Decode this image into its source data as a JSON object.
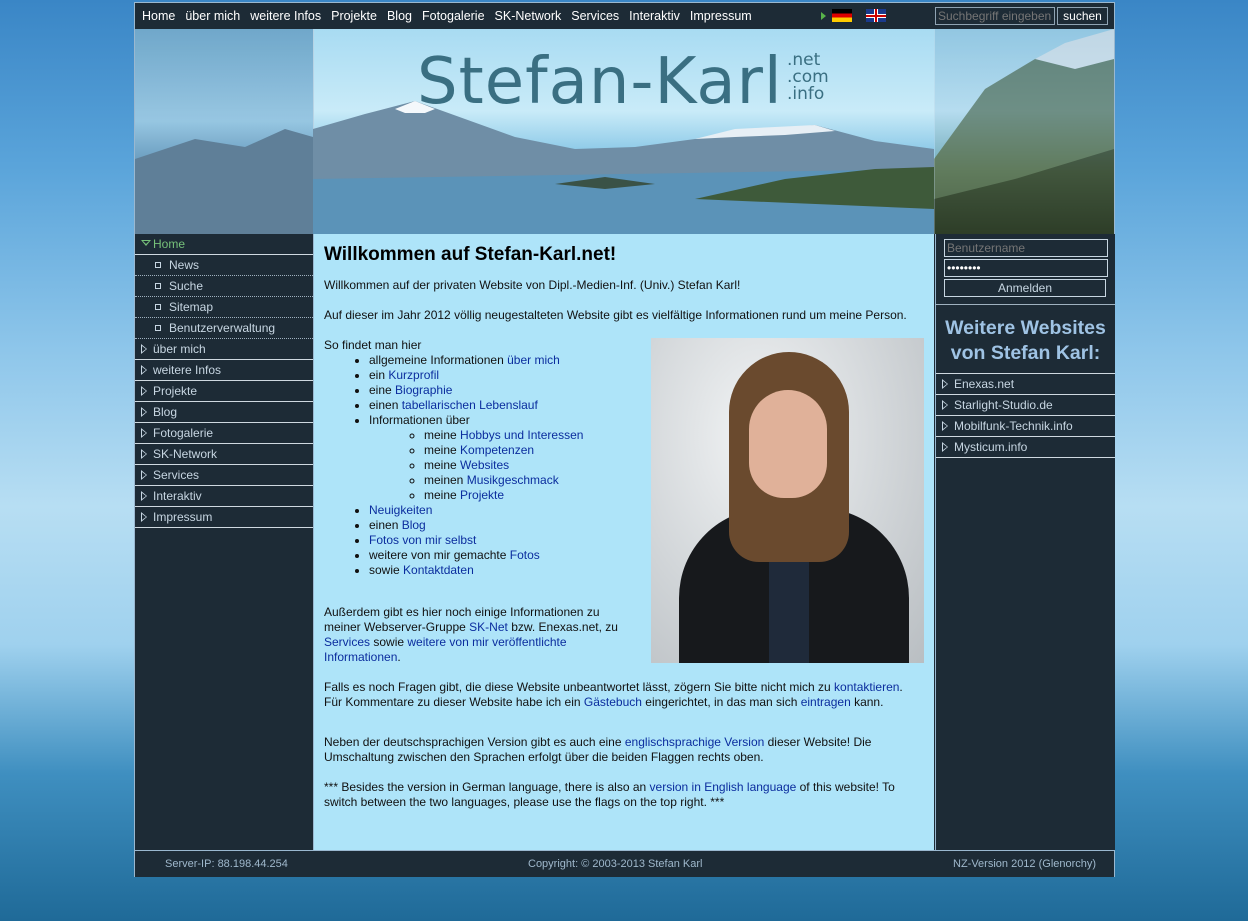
{
  "topnav": [
    "Home",
    "über mich",
    "weitere Infos",
    "Projekte",
    "Blog",
    "Fotogalerie",
    "SK-Network",
    "Services",
    "Interaktiv",
    "Impressum"
  ],
  "search": {
    "placeholder": "Suchbegriff eingeben",
    "button": "suchen"
  },
  "logo": {
    "main": "Stefan-Karl",
    "tlds": [
      ".net",
      ".com",
      ".info"
    ]
  },
  "leftnav": {
    "active": "Home",
    "subitems": [
      "News",
      "Suche",
      "Sitemap",
      "Benutzerverwaltung"
    ],
    "items": [
      "über mich",
      "weitere Infos",
      "Projekte",
      "Blog",
      "Fotogalerie",
      "SK-Network",
      "Services",
      "Interaktiv",
      "Impressum"
    ]
  },
  "content": {
    "title": "Willkommen auf Stefan-Karl.net!",
    "p1": "Willkommen auf der privaten Website von Dipl.-Medien-Inf. (Univ.) Stefan Karl!",
    "p2": "Auf dieser im Jahr 2012 völlig neugestalteten Website gibt es vielfältige Informationen rund um meine Person.",
    "list_intro": "So findet man hier",
    "list": {
      "l1": {
        "pre": "allgemeine Informationen ",
        "link": "über mich"
      },
      "l2": {
        "pre": "ein ",
        "link": "Kurzprofil"
      },
      "l3": {
        "pre": "eine ",
        "link": "Biographie"
      },
      "l4": {
        "pre": "einen ",
        "link": "tabellarischen Lebenslauf"
      },
      "l5": {
        "pre": "Informationen über"
      },
      "s1": {
        "pre": "meine ",
        "link": "Hobbys und Interessen"
      },
      "s2": {
        "pre": "meine ",
        "link": "Kompetenzen"
      },
      "s3": {
        "pre": "meine ",
        "link": "Websites"
      },
      "s4": {
        "pre": "meinen ",
        "link": "Musikgeschmack"
      },
      "s5": {
        "pre": "meine ",
        "link": "Projekte"
      },
      "l6": {
        "link": "Neuigkeiten"
      },
      "l7": {
        "pre": "einen ",
        "link": "Blog"
      },
      "l8": {
        "link": "Fotos von mir selbst"
      },
      "l9": {
        "pre": "weitere von mir gemachte ",
        "link": "Fotos"
      },
      "l10": {
        "pre": "sowie ",
        "link": "Kontaktdaten"
      }
    },
    "p3": {
      "t1": "Außerdem gibt es hier noch einige Informationen zu meiner Webserver-Gruppe ",
      "a1": "SK-Net",
      "t2": " bzw. Enexas.net, zu ",
      "a2": "Services",
      "t3": " sowie ",
      "a3": "weitere von mir veröffentlichte Informationen",
      "t4": "."
    },
    "p4": {
      "t1": "Falls es noch Fragen gibt, die diese Website unbeantwortet lässt, zögern Sie bitte nicht mich zu ",
      "a1": "kontaktieren",
      "t2": ". Für Kommentare zu dieser Website habe ich ein ",
      "a2": "Gästebuch",
      "t3": " eingerichtet, in das man sich ",
      "a3": "eintragen",
      "t4": " kann."
    },
    "p5": {
      "t1": "Neben der deutschsprachigen Version gibt es auch eine ",
      "a1": "englischsprachige Version",
      "t2": " dieser Website! Die Umschaltung zwischen den Sprachen erfolgt über die beiden Flaggen rechts oben."
    },
    "p6": {
      "t1": "*** Besides the version in German language, there is also an ",
      "a1": "version in English language",
      "t2": " of this website! To switch between the two languages, please use the flags on the top right. ***"
    }
  },
  "login": {
    "username_placeholder": "Benutzername",
    "password_value": "********",
    "button": "Anmelden"
  },
  "more": {
    "title": "Weitere Websites von Stefan Karl:",
    "sites": [
      "Enexas.net",
      "Starlight-Studio.de",
      "Mobilfunk-Technik.info",
      "Mysticum.info"
    ]
  },
  "footer": {
    "ip": "Server-IP: 88.198.44.254",
    "copyright": "Copyright: © 2003-2013 Stefan Karl",
    "version": "NZ-Version 2012 (Glenorchy)"
  },
  "colors": {
    "dark": "#1d2b36",
    "content_bg": "#aee4f9",
    "link": "#0b2d9e",
    "active": "#76c17a"
  }
}
